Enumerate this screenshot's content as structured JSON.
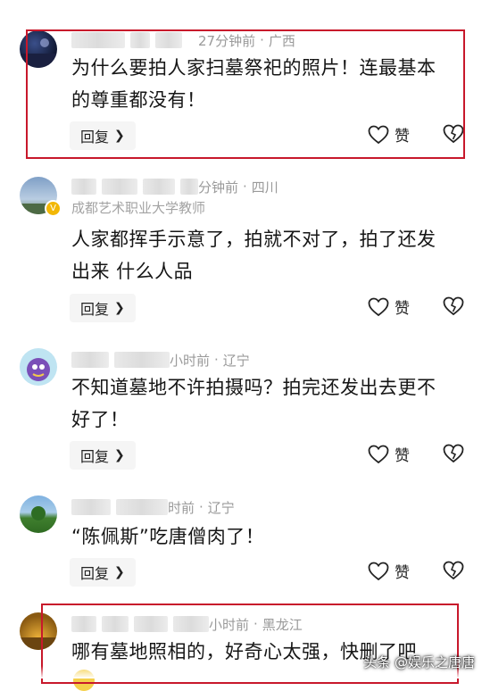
{
  "comments": [
    {
      "time": "27分钟前",
      "location": "广西",
      "subtitle": "",
      "text_lines": [
        "为什么要拍人家扫墓祭祀的照片！连最基本",
        "的尊重都没有！"
      ],
      "reply_label": "回复",
      "like_label": "赞",
      "avatar": "night-scene-avatar",
      "highlighted": true
    },
    {
      "time": "分钟前",
      "location": "四川",
      "subtitle": "成都艺术职业大学教师",
      "text_lines": [
        "人家都挥手示意了，拍就不对了，拍了还发",
        "出来 什么人品"
      ],
      "reply_label": "回复",
      "like_label": "赞",
      "avatar": "sky-avatar",
      "highlighted": false
    },
    {
      "time": "小时前",
      "location": "辽宁",
      "subtitle": "",
      "text_lines": [
        "不知道墓地不许拍摄吗？拍完还发出去更不",
        "好了！"
      ],
      "reply_label": "回复",
      "like_label": "赞",
      "avatar": "cartoon-avatar",
      "highlighted": false
    },
    {
      "time": "时前",
      "location": "辽宁",
      "subtitle": "",
      "text_lines": [
        "“陈佩斯”吃唐僧肉了！"
      ],
      "reply_label": "回复",
      "like_label": "赞",
      "avatar": "landscape-avatar",
      "highlighted": false
    },
    {
      "time": "小时前",
      "location": "黑龙江",
      "subtitle": "",
      "text_lines": [
        "哪有墓地照相的，好奇心太强，快删了吧"
      ],
      "reply_label": "",
      "like_label": "",
      "avatar": "sunset-avatar",
      "highlighted": true
    }
  ],
  "separator": "·",
  "watermark": "头条 @娱乐之唐唐",
  "colors": {
    "highlight": "#c8182b",
    "meta": "#9a9a9a",
    "button_bg": "#f5f5f5"
  },
  "icons": [
    "heart-icon",
    "broken-heart-icon",
    "chevron-right-icon",
    "verified-badge-icon"
  ]
}
